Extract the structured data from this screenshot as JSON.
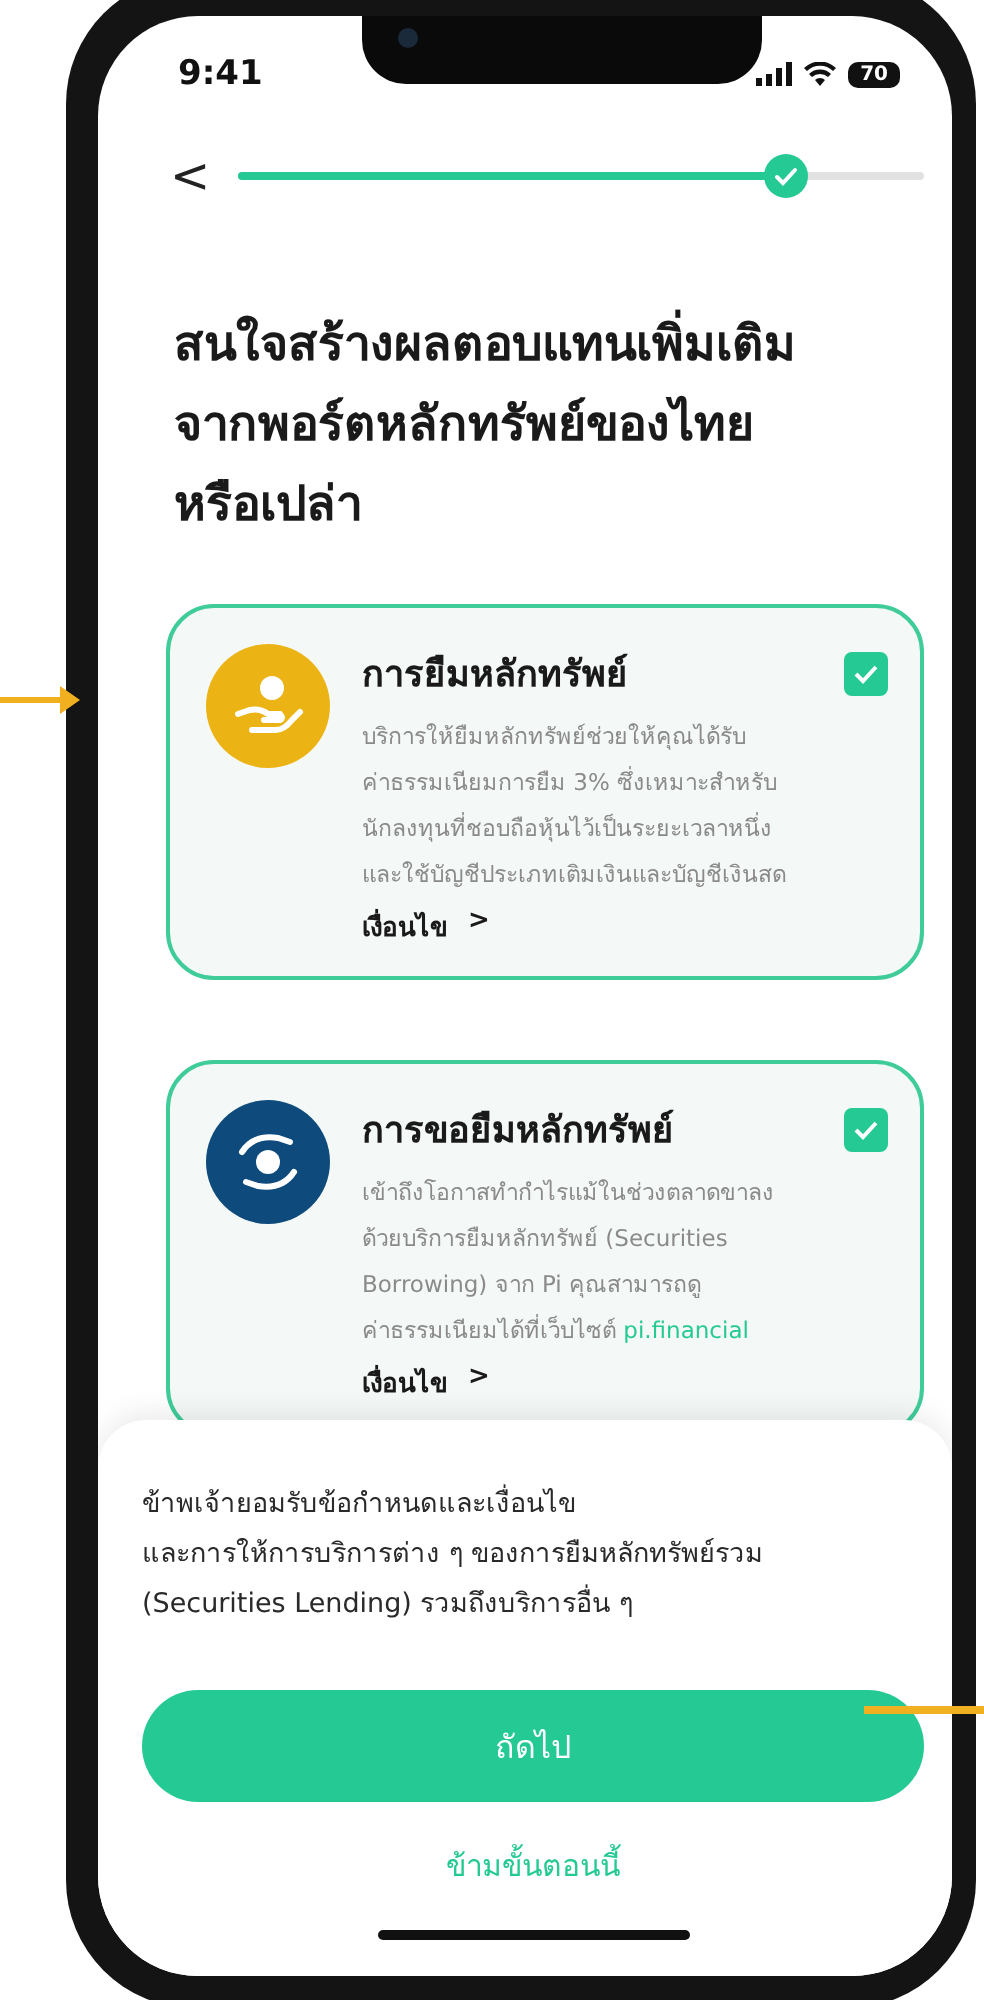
{
  "status_bar": {
    "time": "9:41",
    "battery": "70"
  },
  "progress": {
    "level": 0.8
  },
  "back": "<",
  "title_lines": [
    "สนใจสร้างผลตอบแทนเพิ่มเติม",
    "จากพอร์ตหลักทรัพย์ของไทย",
    "หรือเปล่า"
  ],
  "cards": [
    {
      "kind": "lending",
      "title": "การยืมหลักทรัพย์",
      "description_lines": [
        "บริการให้ยืมหลักทรัพย์ช่วยให้คุณได้รับ",
        "ค่าธรรมเนียมการยืม 3% ซึ่งเหมาะสำหรับ",
        "นักลงทุนที่ชอบถือหุ้นไว้เป็นระยะเวลาหนึ่ง",
        "และใช้บัญชีประเภทเติมเงินและบัญชีเงินสด"
      ],
      "terms": "เงื่อนไข",
      "chevron": ">",
      "checked": true
    },
    {
      "kind": "borrowing",
      "title": "การขอยืมหลักทรัพย์",
      "description_lines": [
        "เข้าถึงโอกาสทำกำไรแม้ในช่วงตลาดขาลง",
        "ด้วยบริการยืมหลักทรัพย์ (Securities",
        "Borrowing) จาก Pi คุณสามารถดู",
        "ค่าธรรมเนียมได้ที่เว็บไซต์"
      ],
      "link": "pi.financial",
      "terms": "เงื่อนไข",
      "chevron": ">",
      "checked": true
    }
  ],
  "sheet": {
    "consent_lines": [
      "ข้าพเจ้ายอมรับข้อกำหนดและเงื่อนไข",
      "และการให้การบริการต่าง ๆ ของการยืมหลักทรัพย์รวม",
      "(Securities Lending) รวมถึงบริการอื่น ๆ"
    ],
    "primary_button": "ถัดไป",
    "skip_link": "ข้ามขั้นตอนนี้"
  }
}
